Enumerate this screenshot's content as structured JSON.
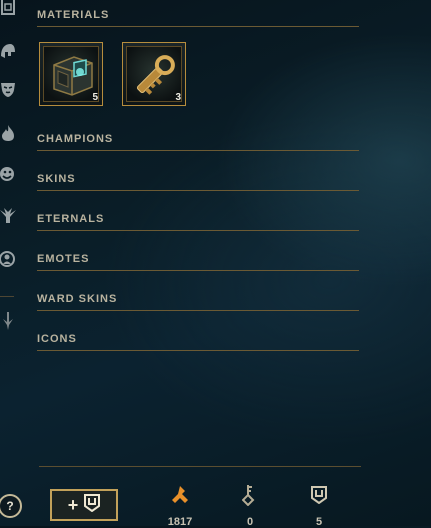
{
  "sections": {
    "materials": "MATERIALS",
    "champions": "CHAMPIONS",
    "skins": "SKINS",
    "eternals": "ETERNALS",
    "emotes": "EMOTES",
    "ward_skins": "WARD SKINS",
    "icons": "ICONS"
  },
  "materials": [
    {
      "icon": "hextech-chest-icon",
      "count": "5"
    },
    {
      "icon": "hextech-key-icon",
      "count": "3"
    }
  ],
  "rail_icons": [
    "chest-icon",
    "helmet-icon",
    "mask-icon",
    "flame-icon",
    "emote-face-icon",
    "ward-icon",
    "profile-icon",
    "sword-icon"
  ],
  "footer": {
    "help_label": "?",
    "buy_chest_label": "+",
    "currencies": [
      {
        "icon": "orange-essence-icon",
        "value": "1817"
      },
      {
        "icon": "key-fragment-icon",
        "value": "0"
      },
      {
        "icon": "chest-count-icon",
        "value": "5"
      }
    ]
  },
  "colors": {
    "accent_gold": "#c8aa6e",
    "orange_essence": "#e8902a",
    "text": "#b9b39f"
  }
}
